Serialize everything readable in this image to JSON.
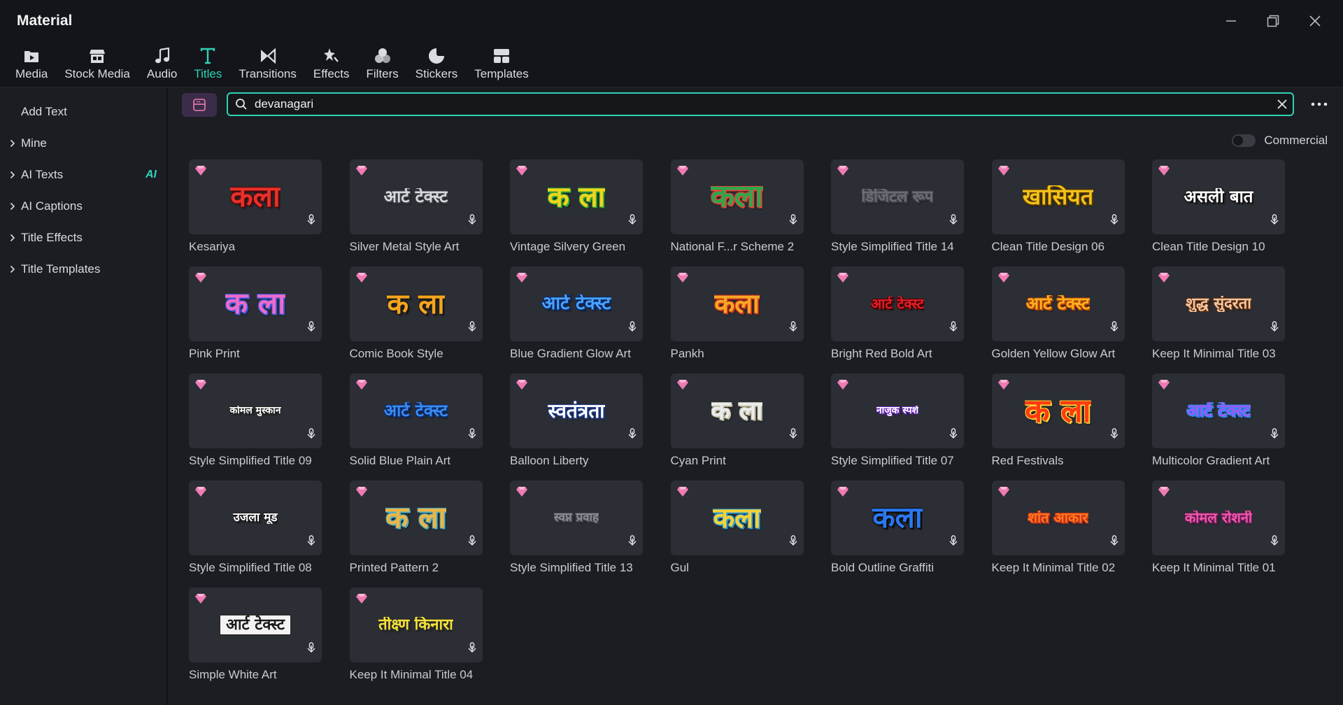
{
  "window": {
    "title": "Material"
  },
  "toolbar": {
    "tabs": [
      {
        "label": "Media",
        "icon": "media-icon"
      },
      {
        "label": "Stock Media",
        "icon": "stock-media-icon"
      },
      {
        "label": "Audio",
        "icon": "music-note-icon"
      },
      {
        "label": "Titles",
        "icon": "text-t-icon"
      },
      {
        "label": "Transitions",
        "icon": "transitions-icon"
      },
      {
        "label": "Effects",
        "icon": "effects-icon"
      },
      {
        "label": "Filters",
        "icon": "filters-icon"
      },
      {
        "label": "Stickers",
        "icon": "stickers-icon"
      },
      {
        "label": "Templates",
        "icon": "templates-icon"
      }
    ],
    "active": "Titles",
    "accent": "#2fd3b5"
  },
  "sidebar": {
    "items": [
      {
        "label": "Add Text",
        "expandable": false
      },
      {
        "label": "Mine",
        "expandable": true
      },
      {
        "label": "AI Texts",
        "expandable": true,
        "badge": "AI"
      },
      {
        "label": "AI Captions",
        "expandable": true
      },
      {
        "label": "Title Effects",
        "expandable": true
      },
      {
        "label": "Title Templates",
        "expandable": true
      }
    ]
  },
  "search": {
    "value": "devanagari"
  },
  "filter": {
    "commercial_label": "Commercial",
    "commercial_on": false
  },
  "titles": [
    {
      "name": "Kesariya",
      "preview": "कला",
      "color": "#e8302a",
      "stroke": "#4a0a0a",
      "size": 42
    },
    {
      "name": "Silver Metal Style Art",
      "preview": "आर्ट टेक्स्ट",
      "color": "#d7d9dc",
      "stroke": "#3a3d42",
      "size": 24
    },
    {
      "name": "Vintage Silvery Green",
      "preview": "क ला",
      "color": "#f3d51a",
      "stroke": "#2da63a",
      "size": 40
    },
    {
      "name": "National F...r Scheme 2",
      "preview": "कला",
      "color": "#2fa74a",
      "stroke": "#e8403a",
      "size": 44
    },
    {
      "name": "Style Simplified Title 14",
      "preview": "डिजिटल रूप",
      "color": "#6a6d73",
      "stroke": "#44474d",
      "size": 22
    },
    {
      "name": "Clean Title Design 06",
      "preview": "खासियत",
      "color": "#f2c21a",
      "stroke": "#5a3a00",
      "size": 32
    },
    {
      "name": "Clean Title Design 10",
      "preview": "असली बात",
      "color": "#ffffff",
      "stroke": "#111111",
      "size": 24
    },
    {
      "name": "Pink Print",
      "preview": "क ला",
      "color": "#f06ac8",
      "stroke": "#3a58e0",
      "size": 42
    },
    {
      "name": "Comic Book Style",
      "preview": "क ला",
      "color": "#f5a51e",
      "stroke": "#1a1a1a",
      "size": 40
    },
    {
      "name": "Blue Gradient Glow Art",
      "preview": "आर्ट टेक्स्ट",
      "color": "#4aa3ff",
      "stroke": "#0a2a6a",
      "size": 26
    },
    {
      "name": "Pankh",
      "preview": "कला",
      "color": "#f5a823",
      "stroke": "#c8301e",
      "size": 38
    },
    {
      "name": "Bright Red Bold Art",
      "preview": "आर्ट टेक्स्ट",
      "color": "#e0202a",
      "stroke": "#4a0000",
      "size": 20
    },
    {
      "name": "Golden Yellow Glow Art",
      "preview": "आर्ट टेक्स्ट",
      "color": "#ffb21e",
      "stroke": "#b3420a",
      "size": 24
    },
    {
      "name": "Keep It Minimal Title 03",
      "preview": "शुद्ध सुंदरता",
      "color": "#f3c7a0",
      "stroke": "#5a2a10",
      "size": 22
    },
    {
      "name": "Style Simplified Title 09",
      "preview": "कोमल मुस्कान",
      "color": "#ffffff",
      "stroke": "#222222",
      "size": 14
    },
    {
      "name": "Solid Blue Plain Art",
      "preview": "आर्ट टेक्स्ट",
      "color": "#3a8bf0",
      "stroke": "#0a2a6a",
      "size": 24
    },
    {
      "name": "Balloon Liberty",
      "preview": "स्वतंत्रता",
      "color": "#ffffff",
      "stroke": "#1c3a8a",
      "size": 28
    },
    {
      "name": "Cyan Print",
      "preview": "क ला",
      "color": "#e8ecef",
      "stroke": "#c6c0a0",
      "size": 36
    },
    {
      "name": "Style Simplified Title 07",
      "preview": "नाजुक स्पर्श",
      "color": "#ffffff",
      "stroke": "#6a2ac0",
      "size": 14
    },
    {
      "name": "Red Festivals",
      "preview": "क ला",
      "color": "#ff3a10",
      "stroke": "#ffd23a",
      "size": 46
    },
    {
      "name": "Multicolor Gradient Art",
      "preview": "आर्ट टेक्स्ट",
      "color": "#9a5af5",
      "stroke": "#2a8af0",
      "size": 24
    },
    {
      "name": "Style Simplified Title 08",
      "preview": "उजला मूड",
      "color": "#ffffff",
      "stroke": "#1a1a1a",
      "size": 17
    },
    {
      "name": "Printed Pattern 2",
      "preview": "क ला",
      "color": "#f0b440",
      "stroke": "#4ab0c8",
      "size": 42
    },
    {
      "name": "Style Simplified Title 13",
      "preview": "स्वप्न प्रवाह",
      "color": "#8a8d93",
      "stroke": "#44474d",
      "size": 17
    },
    {
      "name": "Gul",
      "preview": "कला",
      "color": "#f5d23a",
      "stroke": "#2a9ad0",
      "size": 40
    },
    {
      "name": "Bold Outline Graffiti",
      "preview": "कला",
      "color": "#2a78f0",
      "stroke": "#0a0a0a",
      "size": 42
    },
    {
      "name": "Keep It Minimal Title 02",
      "preview": "शांत आकार",
      "color": "#ff7a1a",
      "stroke": "#c8301e",
      "size": 20
    },
    {
      "name": "Keep It Minimal Title 01",
      "preview": "कोमल रोशनी",
      "color": "#f05aa8",
      "stroke": "#6a1a5a",
      "size": 20
    },
    {
      "name": "Simple White Art",
      "preview": "आर्ट टेक्स्ट",
      "color": "#1a1a1a",
      "stroke": "#f5f5f5",
      "size": 22,
      "boxed": true
    },
    {
      "name": "Keep It Minimal Title 04",
      "preview": "तीक्ष्ण किनारा",
      "color": "#f5e23a",
      "stroke": "#2a2a2a",
      "size": 22
    }
  ],
  "colors": {
    "premium_gem": "#f07ab4",
    "accent": "#2fd3b5"
  }
}
